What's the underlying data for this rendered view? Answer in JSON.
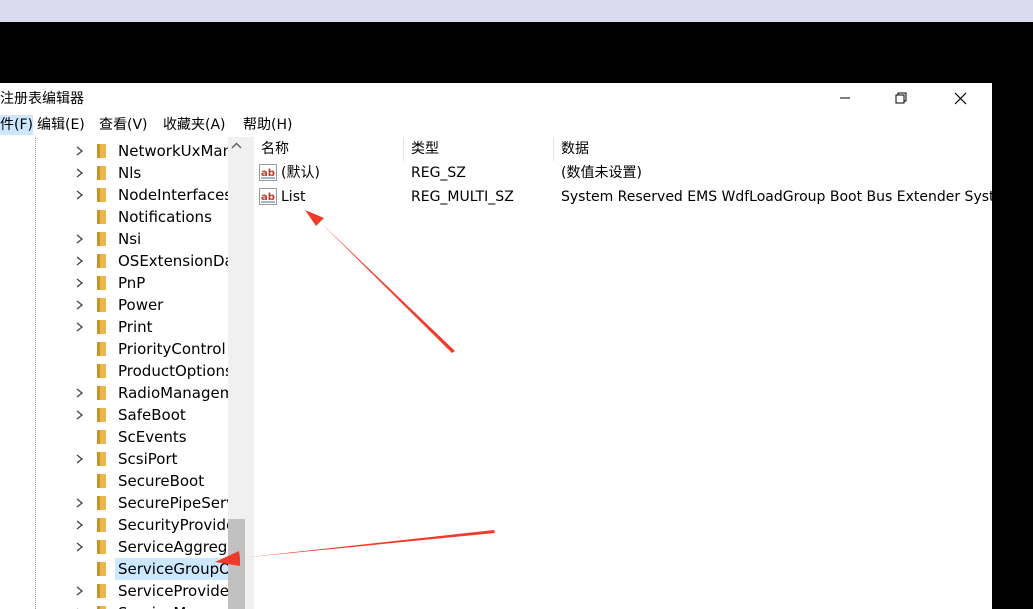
{
  "window": {
    "title": "注册表编辑器"
  },
  "menu": [
    {
      "label": "件(F)",
      "active": true
    },
    {
      "label": "编辑(E)",
      "active": false
    },
    {
      "label": "查看(V)",
      "active": false
    },
    {
      "label": "收藏夹(A)",
      "active": false
    },
    {
      "label": "帮助(H)",
      "active": false
    }
  ],
  "tree": {
    "items": [
      {
        "label": "NetworkUxManager",
        "expandable": true,
        "selected": false
      },
      {
        "label": "Nls",
        "expandable": true,
        "selected": false
      },
      {
        "label": "NodeInterfaces",
        "expandable": true,
        "selected": false
      },
      {
        "label": "Notifications",
        "expandable": false,
        "selected": false
      },
      {
        "label": "Nsi",
        "expandable": true,
        "selected": false
      },
      {
        "label": "OSExtensionDatabase",
        "expandable": true,
        "selected": false
      },
      {
        "label": "PnP",
        "expandable": true,
        "selected": false
      },
      {
        "label": "Power",
        "expandable": true,
        "selected": false
      },
      {
        "label": "Print",
        "expandable": true,
        "selected": false
      },
      {
        "label": "PriorityControl",
        "expandable": false,
        "selected": false
      },
      {
        "label": "ProductOptions",
        "expandable": false,
        "selected": false
      },
      {
        "label": "RadioManagement",
        "expandable": true,
        "selected": false
      },
      {
        "label": "SafeBoot",
        "expandable": true,
        "selected": false
      },
      {
        "label": "ScEvents",
        "expandable": false,
        "selected": false
      },
      {
        "label": "ScsiPort",
        "expandable": true,
        "selected": false
      },
      {
        "label": "SecureBoot",
        "expandable": false,
        "selected": false
      },
      {
        "label": "SecurePipeServers",
        "expandable": true,
        "selected": false
      },
      {
        "label": "SecurityProviders",
        "expandable": true,
        "selected": false
      },
      {
        "label": "ServiceAggregatedEvents",
        "expandable": true,
        "selected": false
      },
      {
        "label": "ServiceGroupOrder",
        "expandable": false,
        "selected": true
      },
      {
        "label": "ServiceProvider",
        "expandable": true,
        "selected": false
      },
      {
        "label": "ServiceMe",
        "expandable": true,
        "selected": false
      }
    ]
  },
  "list": {
    "columns": {
      "name": "名称",
      "type": "类型",
      "data": "数据"
    },
    "rows": [
      {
        "name": "(默认)",
        "type": "REG_SZ",
        "data": "(数值未设置)"
      },
      {
        "name": "List",
        "type": "REG_MULTI_SZ",
        "data": "System Reserved EMS WdfLoadGroup Boot Bus Extender System"
      }
    ]
  },
  "colors": {
    "selection": "#cce8ff",
    "folder": "#e8b84a",
    "arrow": "#f23a2a",
    "background_top": "#d8dcee"
  },
  "icons": {
    "folder": "folder-icon",
    "string_value": "ab-string-icon",
    "expand": "chevron-right-icon"
  }
}
